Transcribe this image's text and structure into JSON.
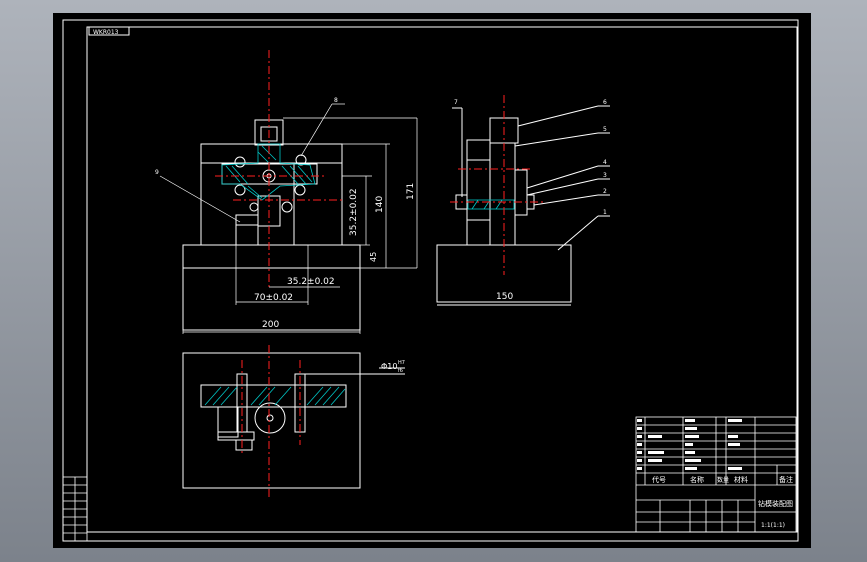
{
  "drawing": {
    "stamp_top_left": "WKR013",
    "part_labels": {
      "p1": "1",
      "p2": "2",
      "p3": "3",
      "p4": "4",
      "p5": "5",
      "p6": "6",
      "p7": "7",
      "p8": "8",
      "p9": "9"
    },
    "dimensions": {
      "d_200": "200",
      "d_150": "150",
      "d_70": "70±0.02",
      "d_35_h": "35.2±0.02",
      "d_35_v": "35.2±0.02",
      "d_140": "140",
      "d_171": "171",
      "d_45": "45",
      "d_phi10": "Φ10",
      "d_phi10_fit_top": "H7",
      "d_phi10_fit_bot": "f6"
    },
    "title_block": {
      "hdr_code": "代号",
      "hdr_name": "名称",
      "hdr_qty": "数量",
      "hdr_material": "材料",
      "hdr_remark": "备注",
      "title": "钻模装配图",
      "drawing_no": "1:1(1:1)"
    },
    "colors": {
      "background": "#000000",
      "line": "#ffffff",
      "center_line": "#ff2020",
      "section": "#00c8c8",
      "frame": "#8b9098"
    }
  }
}
